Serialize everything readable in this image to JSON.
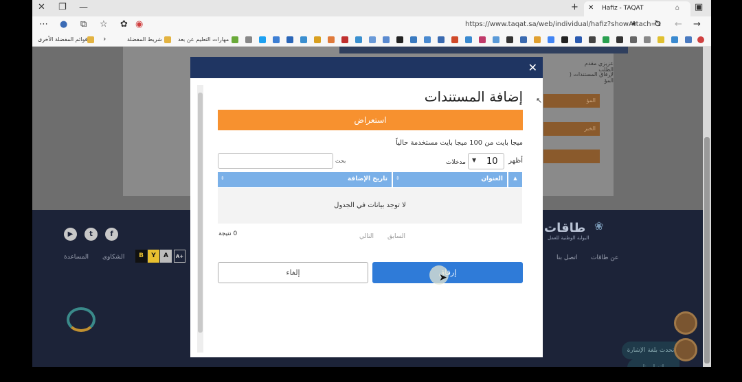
{
  "browser": {
    "tab_title": "Hafiz - TAQAT",
    "url": "https://www.taqat.sa/web/individual/hafiz?showAttach=1",
    "bookmarks": {
      "other_favorites": "قوائم المفضلة الأخرى",
      "favorites_bar": "شريط المفضلة",
      "remote_learning": "مهارات التعليم عن بعد"
    }
  },
  "background": {
    "intro_line1": "عزيزي مقدم الطلب",
    "intro_line2": "لإرفاق المستندات ( المؤ",
    "btn1": "المؤ",
    "btn2": "الخبر",
    "footer": {
      "brand": "طاقات",
      "brand_sub": "البوابة الوطنية للعمل",
      "links": [
        "عن طاقات",
        "اتصل بنا",
        "الشكاوى",
        "المساعدة"
      ],
      "accessibility": [
        "B",
        "Y",
        "A",
        "A+"
      ],
      "contact_pill": "اتصل بنا",
      "sign_pill": "تحدث بلغة الإشارة"
    }
  },
  "modal": {
    "title": "إضافة المستندات",
    "browse_label": "استعراض",
    "usage_note": "ميجا بايت من 100 ميجا بايت مستخدمة حالياً",
    "show_label": "أظهر",
    "page_size": "10",
    "entries_label": "مدخلات",
    "search_label": "بحث",
    "search_placeholder": "",
    "columns": [
      "العنوان",
      "تاريخ الإضافة"
    ],
    "empty_text": "لا توجد بيانات في الجدول",
    "result_count": "0 نتيجة",
    "prev_label": "السابق",
    "next_label": "التالي",
    "cancel_label": "إلغاء",
    "attach_label": "إرفاق"
  }
}
